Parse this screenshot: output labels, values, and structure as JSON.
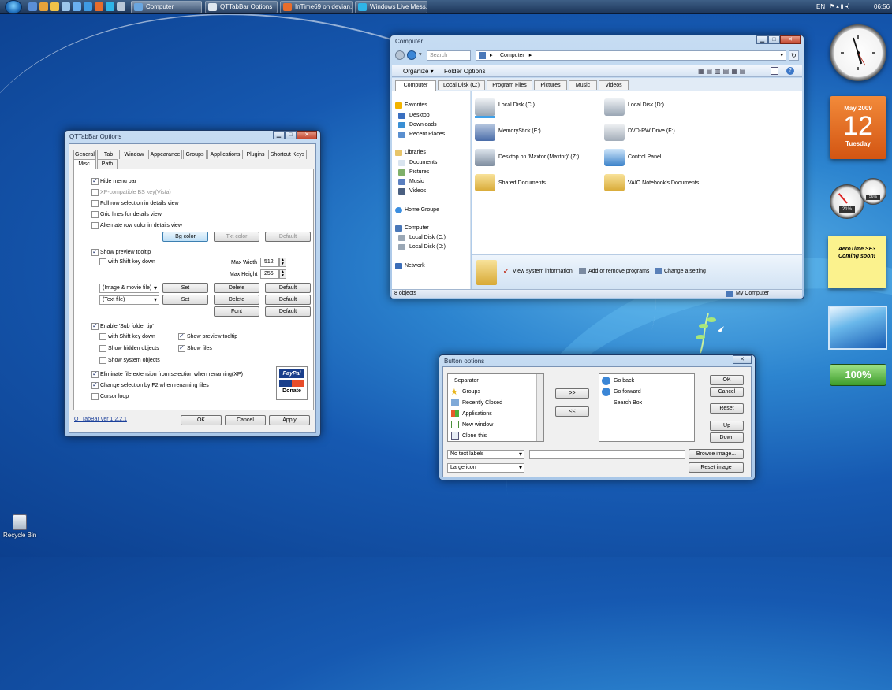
{
  "taskbar": {
    "tasks": [
      "Computer",
      "QTTabBar Options",
      "InTime69 on devian...",
      "Windows Live Mess..."
    ],
    "language": "EN",
    "time": "06:56"
  },
  "desktop": {
    "recycle_bin": "Recycle Bin"
  },
  "explorer": {
    "title": "Computer",
    "search_placeholder": "Search",
    "address": "Computer",
    "toolbar": [
      "Organize ▾",
      "Folder Options"
    ],
    "tabs": [
      "Computer",
      "Local Disk (C:)",
      "Program Files",
      "Pictures",
      "Music",
      "Videos"
    ],
    "nav": {
      "favorites": "Favorites",
      "favorites_items": [
        "Desktop",
        "Downloads",
        "Recent Places"
      ],
      "libraries": "Libraries",
      "libraries_items": [
        "Documents",
        "Pictures",
        "Music",
        "Videos"
      ],
      "home_group": "Home Groupe",
      "computer": "Computer",
      "computer_items": [
        "Local Disk (C:)",
        "Local Disk (D:)"
      ],
      "network": "Network"
    },
    "items": [
      "Local Disk (C:)",
      "Local Disk (D:)",
      "MemoryStick (E:)",
      "DVD-RW Drive (F:)",
      "Desktop on 'Maxtor (Maxtor)' (Z:)",
      "Control Panel",
      "Shared Documents",
      "VAIO Notebook's Documents"
    ],
    "tasks": [
      "View system information",
      "Add or remove programs",
      "Change a setting"
    ],
    "status_left": "8 objects",
    "status_right": "My Computer"
  },
  "qtoptions": {
    "title": "QTTabBar Options",
    "tabs_row1": [
      "General",
      "Tab",
      "Window",
      "Appearance",
      "Groups",
      "Applications",
      "Plugins",
      "Shortcut Keys"
    ],
    "tabs_row2": [
      "Misc.",
      "Path"
    ],
    "hide_menu_bar": "Hide menu bar",
    "xp_bs": "XP-compatible BS key(Vista)",
    "full_row": "Full row selection in details view",
    "grid_lines": "Grid lines for details view",
    "alt_row": "Alternate row color in details view",
    "bg_color": "Bg color",
    "txt_color": "Txt color",
    "default": "Default",
    "show_preview": "Show preview tooltip",
    "with_shift": "with Shift key down",
    "max_width_lbl": "Max Width",
    "max_width": "512",
    "max_height_lbl": "Max Height",
    "max_height": "256",
    "combo_image": "(Image & movie file)",
    "combo_text": "(Text file)",
    "set": "Set",
    "delete": "Delete",
    "font": "Font",
    "enable_sub": "Enable 'Sub folder tip'",
    "show_preview_tt": "Show preview tooltip",
    "show_hidden": "Show hidden objects",
    "show_files": "Show files",
    "show_system": "Show system objects",
    "eliminate_ext": "Eliminate file extension from selection when renaming(XP)",
    "change_sel": "Change selection by F2 when renaming files",
    "cursor_loop": "Cursor loop",
    "paypal": "PayPal",
    "donate": "Donate",
    "version": "QTTabBar ver 1.2.2.1",
    "ok": "OK",
    "cancel": "Cancel",
    "apply": "Apply"
  },
  "buttonoptions": {
    "title": "Button options",
    "left_list": [
      "Separator",
      "Groups",
      "Recently Closed",
      "Applications",
      "New window",
      "Clone this"
    ],
    "right_list": [
      "Go back",
      "Go forward",
      "Search Box"
    ],
    "move_right": ">>",
    "move_left": "<<",
    "ok": "OK",
    "cancel": "Cancel",
    "reset": "Reset",
    "up": "Up",
    "down": "Down",
    "text_labels": "No text labels",
    "icon_size": "Large icon",
    "browse": "Browse image...",
    "reset_image": "Reset image"
  },
  "gadgets": {
    "calendar_month": "May 2009",
    "calendar_day": "12",
    "calendar_weekday": "Tuesday",
    "sticky_line1": "AeroTime SE3",
    "sticky_line2": "Coming soon!",
    "battery": "100%",
    "cpu_left": "21%",
    "cpu_right": "56%"
  }
}
